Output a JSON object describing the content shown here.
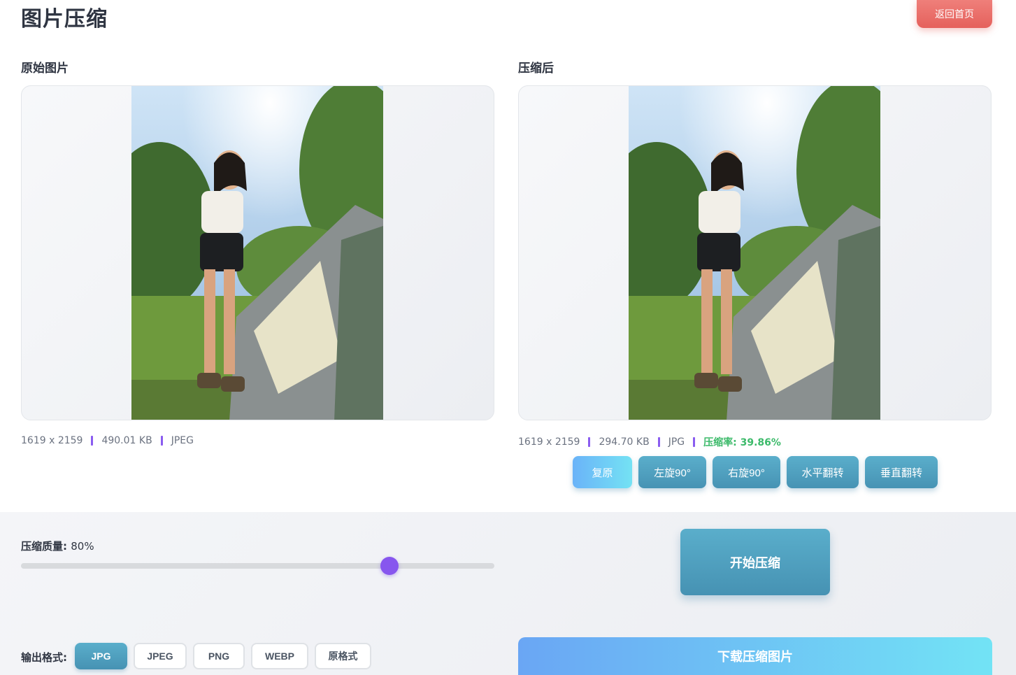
{
  "header": {
    "title": "图片压缩",
    "home_button": "返回首页"
  },
  "original": {
    "title": "原始图片",
    "dimensions": "1619 x 2159",
    "size": "490.01 KB",
    "format": "JPEG"
  },
  "compressed": {
    "title": "压缩后",
    "dimensions": "1619 x 2159",
    "size": "294.70 KB",
    "format": "JPG",
    "rate": "压缩率: 39.86%"
  },
  "tools": [
    "复原",
    "左旋90°",
    "右旋90°",
    "水平翻转",
    "垂直翻转"
  ],
  "quality": {
    "label": "压缩质量:",
    "value_text": "80%",
    "value": 80
  },
  "start_button": "开始压缩",
  "format": {
    "label": "输出格式:",
    "options": [
      "JPG",
      "JPEG",
      "PNG",
      "WEBP",
      "原格式"
    ],
    "selected": "JPG"
  },
  "download_button": "下载压缩图片",
  "colors": {
    "accent": "#4793b4",
    "danger": "#e5615c",
    "purple": "#8756ee",
    "success": "#3cba6a"
  }
}
